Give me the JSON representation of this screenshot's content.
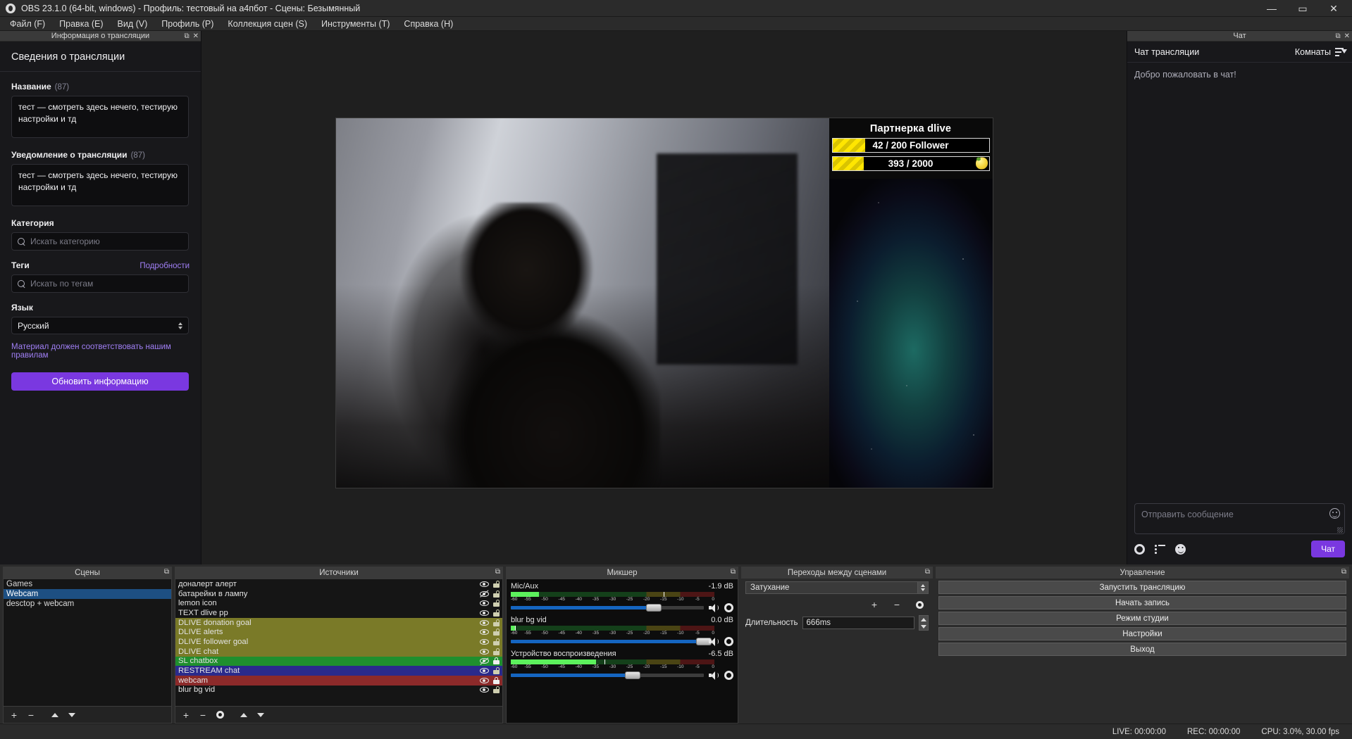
{
  "window": {
    "title": "OBS 23.1.0 (64-bit, windows) - Профиль: тестовый на а4пбот - Сцены: Безымянный",
    "app_icon": "obs-logo-icon",
    "minimize": "—",
    "maximize": "▭",
    "close": "✕"
  },
  "menu": {
    "items": [
      {
        "label": "Файл (F)"
      },
      {
        "label": "Правка (E)"
      },
      {
        "label": "Вид (V)"
      },
      {
        "label": "Профиль (P)"
      },
      {
        "label": "Коллекция сцен (S)"
      },
      {
        "label": "Инструменты (T)"
      },
      {
        "label": "Справка (H)"
      }
    ]
  },
  "stream_info": {
    "dock_title": "Информация о трансляции",
    "heading": "Сведения о трансляции",
    "title_label": "Название",
    "title_count": "(87)",
    "title_value": "тест — смотреть здесь нечего, тестирую настройки и тд",
    "notice_label": "Уведомление о трансляции",
    "notice_count": "(87)",
    "notice_value": "тест — смотреть здесь нечего, тестирую настройки и тд",
    "category_label": "Категория",
    "category_placeholder": "Искать категорию",
    "tags_label": "Теги",
    "tags_link": "Подробности",
    "tags_placeholder": "Искать по тегам",
    "language_label": "Язык",
    "language_value": "Русский",
    "guidelines_note": "Материал должен соответствовать нашим правилам",
    "update_button": "Обновить информацию",
    "accent_color": "#7a38e0"
  },
  "preview": {
    "overlay": {
      "title": "Партнерка dlive",
      "bars": [
        {
          "text": "42 / 200 Follower",
          "fill_percent": 21,
          "has_lemon": false
        },
        {
          "text": "393 / 2000",
          "fill_percent": 20,
          "has_lemon": true
        }
      ]
    }
  },
  "chat": {
    "dock_title": "Чат",
    "header_label": "Чат трансляции",
    "rooms_label": "Комнаты",
    "welcome": "Добро пожаловать в чат!",
    "input_placeholder": "Отправить сообщение",
    "send_button": "Чат"
  },
  "scenes": {
    "dock_title": "Сцены",
    "items": [
      {
        "label": "Games",
        "selected": false
      },
      {
        "label": "Webcam",
        "selected": true
      },
      {
        "label": "desctop + webcam",
        "selected": false
      }
    ],
    "buttons": [
      {
        "name": "add-scene-button",
        "glyph": "+"
      },
      {
        "name": "remove-scene-button",
        "glyph": "−"
      },
      {
        "name": "move-scene-up-button",
        "glyph": "chevron-up"
      },
      {
        "name": "move-scene-down-button",
        "glyph": "chevron-down"
      }
    ]
  },
  "sources": {
    "dock_title": "Источники",
    "items": [
      {
        "label": "доналерт алерт",
        "color": "",
        "visible": true,
        "locked": false
      },
      {
        "label": "батарейки в лампу",
        "color": "",
        "visible": false,
        "locked": false
      },
      {
        "label": "lemon icon",
        "color": "",
        "visible": true,
        "locked": false
      },
      {
        "label": "TEXT dlive pp",
        "color": "",
        "visible": true,
        "locked": false
      },
      {
        "label": "DLIVE donation goal",
        "color": "#7a7a28",
        "visible": true,
        "locked": false
      },
      {
        "label": "DLIVE alerts",
        "color": "#7a7a28",
        "visible": true,
        "locked": false
      },
      {
        "label": "DLIVE follower goal",
        "color": "#7a7a28",
        "visible": true,
        "locked": false
      },
      {
        "label": "DLIVE chat",
        "color": "#7a7a28",
        "visible": true,
        "locked": false
      },
      {
        "label": "SL chatbox",
        "color": "#1f8f2e",
        "visible": false,
        "locked": true
      },
      {
        "label": "RESTREAM chat",
        "color": "#2a2a8c",
        "visible": true,
        "locked": false
      },
      {
        "label": "webcam",
        "color": "#8c2a2a",
        "visible": true,
        "locked": true
      },
      {
        "label": "blur bg vid",
        "color": "",
        "visible": true,
        "locked": false
      }
    ],
    "buttons": [
      {
        "name": "add-source-button",
        "glyph": "+"
      },
      {
        "name": "remove-source-button",
        "glyph": "−"
      },
      {
        "name": "source-properties-button",
        "glyph": "gear"
      },
      {
        "name": "move-source-up-button",
        "glyph": "chevron-up"
      },
      {
        "name": "move-source-down-button",
        "glyph": "chevron-down"
      }
    ]
  },
  "mixer": {
    "dock_title": "Микшер",
    "tick_labels": [
      "-60",
      "-55",
      "-50",
      "-45",
      "-40",
      "-35",
      "-30",
      "-25",
      "-20",
      "-15",
      "-10",
      "-5",
      "0"
    ],
    "channels": [
      {
        "name": "Mic/Aux",
        "db": "-1.9 dB",
        "meter_level_percent": 14,
        "meter_peak_percent": 75,
        "volume_percent": 74
      },
      {
        "name": "blur bg vid",
        "db": "0.0 dB",
        "meter_level_percent": 2,
        "meter_peak_percent": 2,
        "volume_percent": 100
      },
      {
        "name": "Устройство воспроизведения",
        "db": "-6.5 dB",
        "meter_level_percent": 42,
        "meter_peak_percent": 46,
        "volume_percent": 63
      }
    ]
  },
  "transitions": {
    "dock_title": "Переходы между сценами",
    "selected": "Затухание",
    "duration_label": "Длительность",
    "duration_value": "666ms",
    "buttons": [
      {
        "name": "add-transition-button",
        "glyph": "+"
      },
      {
        "name": "remove-transition-button",
        "glyph": "−"
      },
      {
        "name": "transition-properties-button",
        "glyph": "gear"
      }
    ]
  },
  "controls": {
    "dock_title": "Управление",
    "buttons": [
      {
        "label": "Запустить трансляцию",
        "name": "start-streaming-button"
      },
      {
        "label": "Начать запись",
        "name": "start-recording-button"
      },
      {
        "label": "Режим студии",
        "name": "studio-mode-button"
      },
      {
        "label": "Настройки",
        "name": "settings-button"
      },
      {
        "label": "Выход",
        "name": "exit-button"
      }
    ]
  },
  "status_bar": {
    "live": "LIVE: 00:00:00",
    "rec": "REC: 00:00:00",
    "cpu": "CPU: 3.0%, 30.00 fps"
  }
}
